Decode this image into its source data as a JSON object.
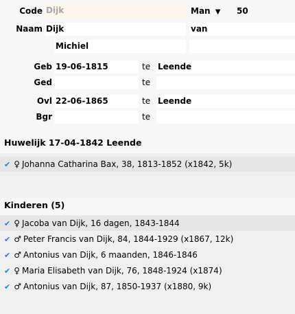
{
  "person": {
    "code_label": "Code",
    "code_value": "Dijk",
    "gender": "Man",
    "gender_arrow": "▼",
    "age": "50",
    "naam_label": "Naam",
    "surname": "Dijk",
    "prefix": "van",
    "firstname": "Michiel",
    "te_label": "te"
  },
  "events": [
    {
      "label": "Geb",
      "date": "19-06-1815",
      "place": "Leende"
    },
    {
      "label": "Ged",
      "date": "",
      "place": ""
    },
    {
      "label": "Ovl",
      "date": "22-06-1865",
      "place": "Leende"
    },
    {
      "label": "Bgr",
      "date": "",
      "place": ""
    }
  ],
  "marriage": {
    "title": "Huwelijk 17-04-1842 Leende",
    "partners": [
      {
        "check": "✔",
        "symbol": "♀",
        "text": "Johanna Catharina Bax, 38, 1813-1852 (x1842, 5k)"
      }
    ]
  },
  "children": {
    "title": "Kinderen (5)",
    "items": [
      {
        "check": "✔",
        "symbol": "♀",
        "text": "Jacoba van Dijk, 16 dagen, 1843-1844"
      },
      {
        "check": "✔",
        "symbol": "♂",
        "text": "Peter Francis van Dijk, 84, 1844-1929 (x1867, 12k)"
      },
      {
        "check": "✔",
        "symbol": "♂",
        "text": "Antonius van Dijk, 6 maanden, 1846-1846"
      },
      {
        "check": "✔",
        "symbol": "♀",
        "text": "Maria Elisabeth van Dijk, 76, 1848-1924 (x1874)"
      },
      {
        "check": "✔",
        "symbol": "♂",
        "text": "Antonius van Dijk, 87, 1850-1937 (x1880, 9k)"
      }
    ]
  }
}
